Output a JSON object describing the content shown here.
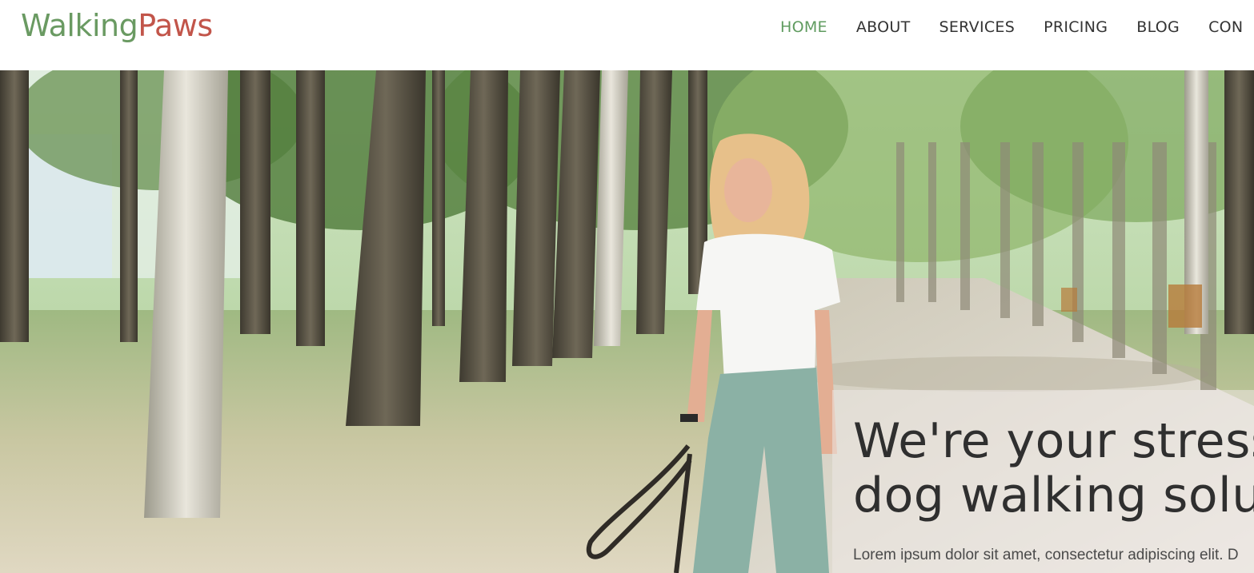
{
  "brand": {
    "logo_part1": "Walking",
    "logo_part2": "Paws"
  },
  "nav": {
    "items": [
      {
        "label": "HOME",
        "active": true
      },
      {
        "label": "ABOUT",
        "active": false
      },
      {
        "label": "SERVICES",
        "active": false
      },
      {
        "label": "PRICING",
        "active": false
      },
      {
        "label": "BLOG",
        "active": false
      },
      {
        "label": "CON",
        "active": false
      }
    ]
  },
  "hero": {
    "title_line1": "We're your stress-",
    "title_line2": "dog walking solu",
    "body": "Lorem ipsum dolor sit amet, consectetur adipiscing elit. D",
    "image": "woman-walking-with-leash-in-birch-park"
  },
  "colors": {
    "logo_green": "#6a9a62",
    "logo_red": "#c2554a",
    "nav_active": "#5f9b5f",
    "nav_text": "#333333",
    "heading": "#2f2f2f"
  }
}
